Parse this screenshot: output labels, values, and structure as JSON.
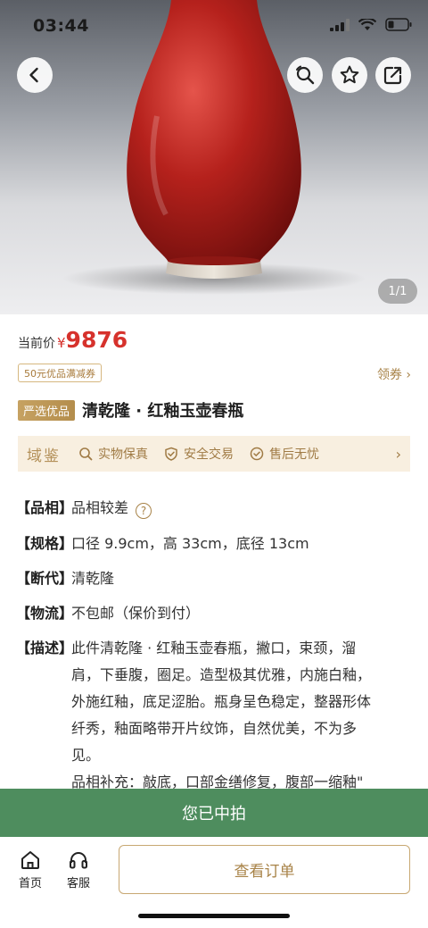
{
  "status_bar": {
    "time": "03:44"
  },
  "hero": {
    "image_counter": "1/1",
    "icons": [
      "back-icon",
      "search-image-icon",
      "star-icon",
      "share-icon"
    ]
  },
  "price": {
    "label": "当前价",
    "currency": "¥",
    "value": "9876",
    "accent_color": "#d6322c"
  },
  "coupon": {
    "tag": "50元优品满减券",
    "link": "领券 ›"
  },
  "product": {
    "badge": "严选优品",
    "title": "清乾隆 · 红釉玉壶春瓶"
  },
  "guarantee": {
    "brand": "域鉴",
    "items": [
      "实物保真",
      "安全交易",
      "售后无忧"
    ],
    "arrow": "›"
  },
  "attributes": [
    {
      "key": "【品相】",
      "value": "品相较差",
      "help": "?"
    },
    {
      "key": "【规格】",
      "value": "口径 9.9cm，高 33cm，底径 13cm"
    },
    {
      "key": "【断代】",
      "value": "清乾隆"
    },
    {
      "key": "【物流】",
      "value": "不包邮（保价到付）"
    }
  ],
  "description": {
    "key": "【描述】",
    "lines": [
      "此件清乾隆 · 红釉玉壶春瓶，撇口，束颈，溜",
      "肩，下垂腹，圈足。造型极其优雅，内施白釉，",
      "外施红釉，底足涩胎。瓶身呈色稳定，整器形体",
      "纤秀，釉面略带开片纹饰，自然优美，不为多",
      "见。",
      "品相补充：敲底，口部金缮修复，腹部一缩釉\""
    ]
  },
  "won_banner": "您已中拍",
  "tabbar": {
    "home": "首页",
    "service": "客服",
    "order_button": "查看订单"
  }
}
